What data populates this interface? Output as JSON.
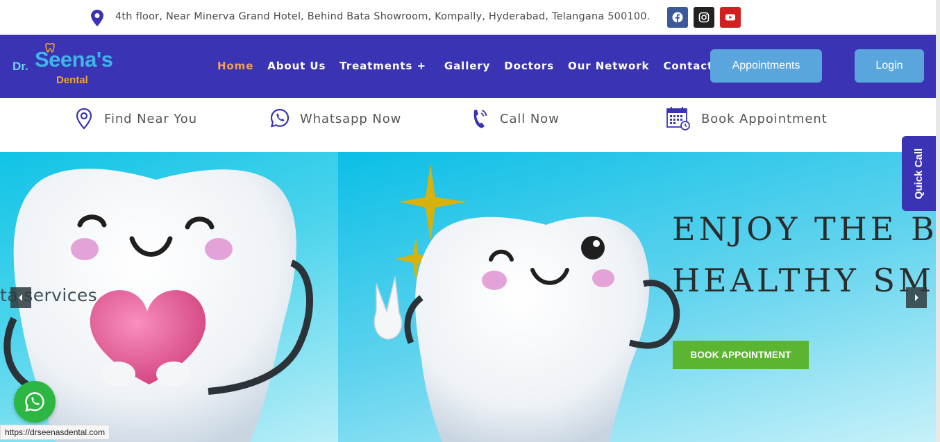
{
  "topbar": {
    "address": "4th floor, Near Minerva Grand Hotel, Behind Bata Showroom, Kompally, Hyderabad, Telangana 500100.",
    "icons": [
      "location-icon",
      "facebook-icon",
      "instagram-icon",
      "youtube-icon"
    ]
  },
  "logo": {
    "dr": "Dr.",
    "name": "Seena's",
    "sub": "Dental"
  },
  "nav": {
    "items": [
      {
        "label": "Home"
      },
      {
        "label": "About Us"
      },
      {
        "label": "Treatments +"
      },
      {
        "label": "Gallery"
      },
      {
        "label": "Doctors"
      },
      {
        "label": "Our Network"
      },
      {
        "label": "Contact Us"
      }
    ],
    "appointments": "Appointments",
    "login": "Login"
  },
  "quick_actions": [
    {
      "label": "Find  Near  You",
      "icon": "map-pin-icon"
    },
    {
      "label": "Whatsapp Now",
      "icon": "whatsapp-icon"
    },
    {
      "label": "Call Now",
      "icon": "phone-icon"
    },
    {
      "label": "Book Appointment",
      "icon": "calendar-icon"
    }
  ],
  "hero": {
    "left_caption": "ta services",
    "title_line1": "ENJOY THE BE",
    "title_line2": "HEALTHY SMI",
    "book_button": "BOOK APPOINTMENT"
  },
  "quick_call": "Quick Call",
  "status_url": "https://drseenasdental.com",
  "colors": {
    "nav_bg": "#3a34b4",
    "nav_active": "#f7a24b",
    "button_blue": "#5aa5dc",
    "book_green": "#5cb531",
    "whatsapp_green": "#2cb742"
  }
}
